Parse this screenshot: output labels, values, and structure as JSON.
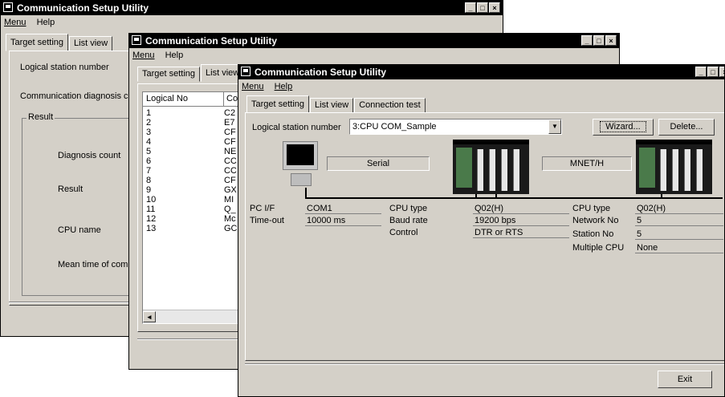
{
  "back_window": {
    "title": "Communication Setup Utility",
    "menu": [
      "Menu",
      "Help"
    ],
    "tabs": [
      "Target setting",
      "List view"
    ],
    "logical_station_label": "Logical station number",
    "comm_diag_label": "Communication diagnosis c",
    "result_group": "Result",
    "diagnosis_count": "Diagnosis count",
    "result": "Result",
    "cpu_name": "CPU name",
    "mean_time": "Mean time of comm"
  },
  "mid_window": {
    "title": "Communication Setup Utility",
    "menu": [
      "Menu",
      "Help"
    ],
    "tabs": [
      "Target setting",
      "List view"
    ],
    "column_logical_no": "Logical No",
    "column_second": "Co",
    "rows": [
      {
        "no": "1",
        "c": "C2"
      },
      {
        "no": "2",
        "c": "E7"
      },
      {
        "no": "3",
        "c": "CF"
      },
      {
        "no": "4",
        "c": "CF"
      },
      {
        "no": "5",
        "c": "NE"
      },
      {
        "no": "6",
        "c": "CC"
      },
      {
        "no": "7",
        "c": "CC"
      },
      {
        "no": "8",
        "c": "CF"
      },
      {
        "no": "9",
        "c": "GX"
      },
      {
        "no": "10",
        "c": "MI"
      },
      {
        "no": "11",
        "c": "Q_"
      },
      {
        "no": "12",
        "c": "Mc"
      },
      {
        "no": "13",
        "c": "GC"
      }
    ],
    "scroll_left": "◂"
  },
  "front_window": {
    "title": "Communication Setup Utility",
    "menu": [
      "Menu",
      "Help"
    ],
    "tabs": [
      "Target setting",
      "List view",
      "Connection test"
    ],
    "logical_station_label": "Logical station number",
    "logical_station_value": "3:CPU COM_Sample",
    "wizard_label": "Wizard...",
    "delete_label": "Delete...",
    "serial_label": "Serial",
    "mnet_label": "MNET/H",
    "pc": {
      "if_label": "PC I/F",
      "if_value": "COM1",
      "timeout_label": "Time-out",
      "timeout_value": "10000 ms"
    },
    "cpu1": {
      "type_label": "CPU type",
      "type_value": "Q02(H)",
      "baud_label": "Baud rate",
      "baud_value": "19200 bps",
      "control_label": "Control",
      "control_value": "DTR or RTS"
    },
    "cpu2": {
      "type_label": "CPU type",
      "type_value": "Q02(H)",
      "network_label": "Network No",
      "network_value": "5",
      "station_label": "Station No",
      "station_value": "5",
      "multi_label": "Multiple CPU",
      "multi_value": "None"
    },
    "exit_label": "Exit"
  },
  "window_buttons": {
    "minimize": "_",
    "maximize": "□",
    "close": "×"
  }
}
